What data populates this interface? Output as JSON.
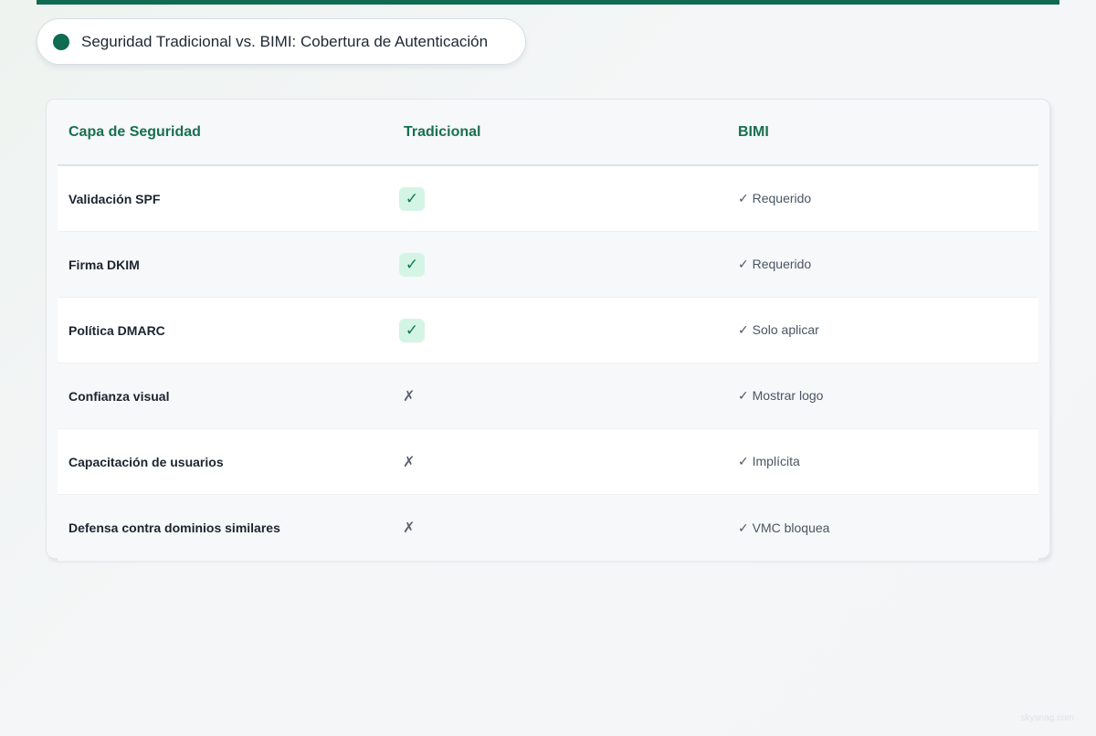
{
  "title": "Seguridad Tradicional vs. BIMI: Cobertura de Autenticación",
  "colors": {
    "accent": "#0f6b52",
    "header_text": "#17704f",
    "check_bg": "#d4f5e5",
    "check_fg": "#0f7a54"
  },
  "table": {
    "headers": [
      "Capa de Seguridad",
      "Tradicional",
      "BIMI"
    ],
    "rows": [
      {
        "layer": "Validación SPF",
        "traditional": "✓",
        "traditional_supported": true,
        "bimi": "✓ Requerido"
      },
      {
        "layer": "Firma DKIM",
        "traditional": "✓",
        "traditional_supported": true,
        "bimi": "✓ Requerido"
      },
      {
        "layer": "Política DMARC",
        "traditional": "✓",
        "traditional_supported": true,
        "bimi": "✓ Solo aplicar"
      },
      {
        "layer": "Confianza visual",
        "traditional": "✗",
        "traditional_supported": false,
        "bimi": "✓ Mostrar logo"
      },
      {
        "layer": "Capacitación de usuarios",
        "traditional": "✗",
        "traditional_supported": false,
        "bimi": "✓ Implícita"
      },
      {
        "layer": "Defensa contra dominios similares",
        "traditional": "✗",
        "traditional_supported": false,
        "bimi": "✓ VMC bloquea"
      }
    ]
  },
  "watermark": "skysnag.com"
}
